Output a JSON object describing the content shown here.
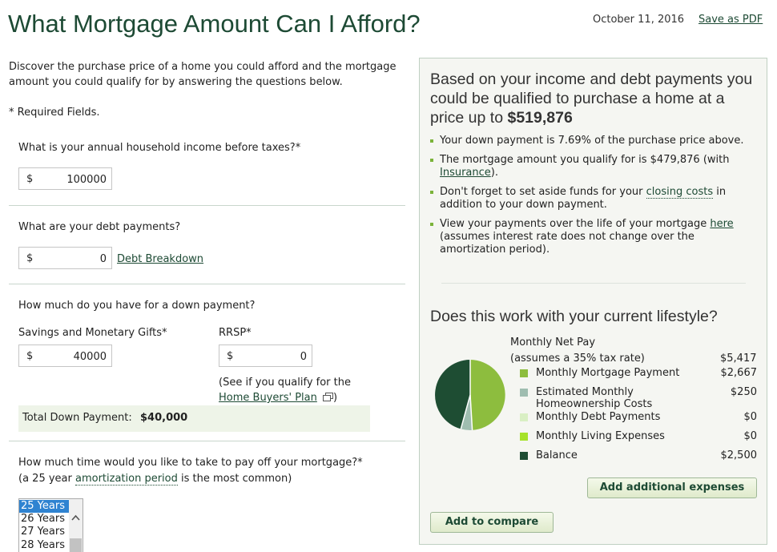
{
  "header": {
    "title": "What Mortgage Amount Can I Afford?",
    "date": "October 11, 2016",
    "save_pdf": "Save as PDF"
  },
  "intro": {
    "text": "Discover the purchase price of a home you could afford and the mortgage amount you could qualify for by answering the questions below.",
    "required": "* Required Fields."
  },
  "income": {
    "question": "What is your annual household income before taxes?*",
    "currency": "$",
    "value": "100000"
  },
  "debt": {
    "question": "What are your debt payments?",
    "currency": "$",
    "value": "0",
    "breakdown_link": "Debt Breakdown"
  },
  "down_payment": {
    "question": "How much do you have for a down payment?",
    "savings_label": "Savings and Monetary Gifts*",
    "savings_currency": "$",
    "savings_value": "40000",
    "rrsp_label": "RRSP*",
    "rrsp_currency": "$",
    "rrsp_value": "0",
    "hbp_prefix": "(See if you qualify for the",
    "hbp_link": "Home Buyers' Plan",
    "hbp_suffix": ")",
    "total_label": "Total Down Payment:",
    "total_value": "$40,000"
  },
  "amortization": {
    "question": "How much time would you like to take to pay off your mortgage?*",
    "note_prefix": "(a 25 year",
    "note_link": "amortization period",
    "note_suffix": "is the most common)",
    "options": [
      "25 Years",
      "26 Years",
      "27 Years",
      "28 Years"
    ],
    "selected": "25 Years"
  },
  "result": {
    "headline": "Based on your income and debt payments you could be qualified to purchase a home at a price up to",
    "amount": "$519,876",
    "bullet1": "Your down payment is 7.69% of the purchase price above.",
    "bullet2_text": "The mortgage amount you qualify for is $479,876 (with",
    "bullet2_link": "Insurance",
    "bullet2_end": ").",
    "bullet3_text": "Don't forget to set aside funds for your",
    "bullet3_link": "closing costs",
    "bullet3_end": "in addition to your down payment.",
    "bullet4_text": "View your payments over the life of your mortgage",
    "bullet4_link": "here",
    "bullet4_end": "(assumes interest rate does not change over the amortization period)."
  },
  "lifestyle": {
    "title": "Does this work with your current lifestyle?",
    "net_pay_label": "Monthly Net Pay",
    "net_pay_note": "(assumes a 35% tax rate)",
    "net_pay_value": "$5,417",
    "items": [
      {
        "label": "Monthly Mortgage Payment",
        "value": "$2,667",
        "color": "#8dbd3e"
      },
      {
        "label": "Estimated Monthly Homeownership Costs",
        "value": "$250",
        "color": "#9fbdb0"
      },
      {
        "label": "Monthly Debt Payments",
        "value": "$0",
        "color": "#d9efc4"
      },
      {
        "label": "Monthly Living Expenses",
        "value": "$0",
        "color": "#a6e22a"
      },
      {
        "label": "Balance",
        "value": "$2,500",
        "color": "#1e4d33"
      }
    ],
    "add_expenses": "Add additional expenses",
    "add_compare": "Add to compare"
  }
}
